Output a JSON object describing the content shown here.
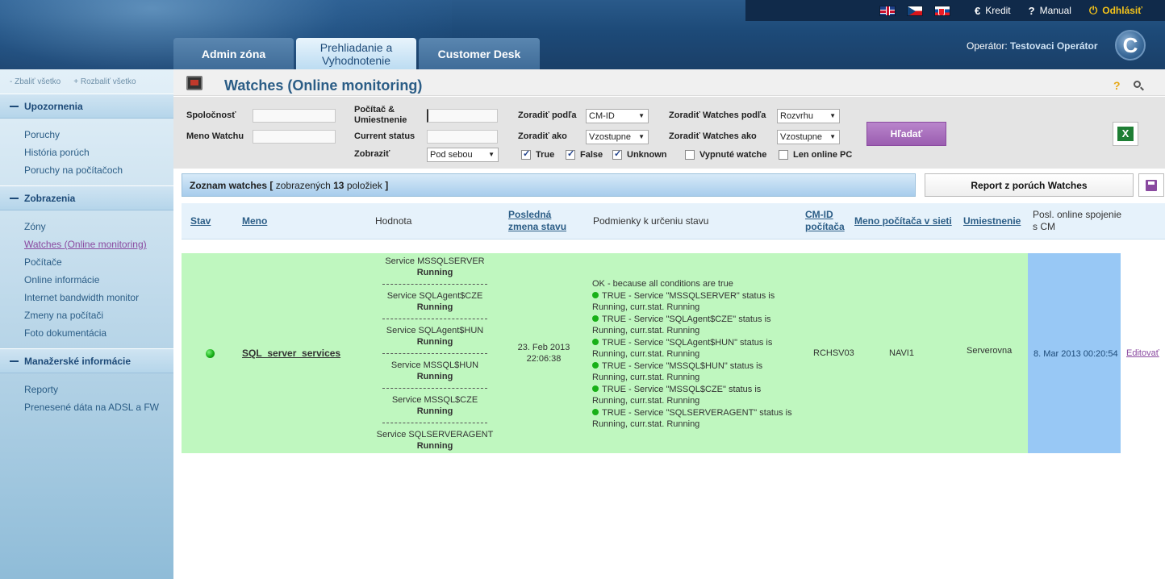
{
  "topbar": {
    "kredit": "Kredit",
    "manual": "Manual",
    "logout": "Odhlásiť"
  },
  "tabs": [
    {
      "label": "Admin zóna"
    },
    {
      "label": "Prehliadanie a Vyhodnotenie"
    },
    {
      "label": "Customer Desk"
    }
  ],
  "operator": {
    "label": "Operátor:",
    "name": "Testovaci Operátor"
  },
  "sidebar": {
    "collapse_all": "Zbaliť všetko",
    "expand_all": "Rozbaliť všetko",
    "sections": [
      {
        "title": "Upozornenia",
        "items": [
          "Poruchy",
          "História porúch",
          "Poruchy na počítačoch"
        ]
      },
      {
        "title": "Zobrazenia",
        "items": [
          "Zóny",
          "Watches (Online monitoring)",
          "Počítače",
          "Online informácie",
          "Internet bandwidth monitor",
          "Zmeny na počítači",
          "Foto dokumentácia"
        ]
      },
      {
        "title": "Manažerské informácie",
        "items": [
          "Reporty",
          "Prenesené dáta na ADSL a FW"
        ]
      }
    ]
  },
  "page": {
    "title": "Watches (Online monitoring)"
  },
  "filters": {
    "spolocnost": "Spoločnosť",
    "meno_watchu": "Meno Watchu",
    "pocitac_umiestnenie_1": "Počítač &",
    "pocitac_umiestnenie_2": "Umiestnenie",
    "current_status": "Current status",
    "zobrazit": "Zobraziť",
    "zobrazit_value": "Pod sebou",
    "zoradit_podla": "Zoradiť podľa",
    "zoradit_podla_value": "CM-ID",
    "zoradit_ako": "Zoradiť ako",
    "zoradit_ako_value": "Vzostupne",
    "zoradit_watches_podla": "Zoradiť Watches podľa",
    "zoradit_watches_podla_value": "Rozvrhu",
    "zoradit_watches_ako": "Zoradiť Watches ako",
    "zoradit_watches_ako_value": "Vzostupne",
    "chk_true": "True",
    "chk_false": "False",
    "chk_unknown": "Unknown",
    "chk_vypnute": "Vypnuté watche",
    "chk_online": "Len online PC",
    "search_button": "Hľadať"
  },
  "list": {
    "title": "Zoznam watches",
    "bracket_open": "[",
    "shown_text": "zobrazených",
    "count": "13",
    "items_text": "položiek",
    "bracket_close": "]",
    "report_button": "Report z porúch Watches"
  },
  "columns": {
    "stav": "Stav",
    "meno": "Meno",
    "hodnota": "Hodnota",
    "posledna_1": "Posledná",
    "posledna_2": "zmena stavu",
    "podmienky": "Podmienky k určeniu stavu",
    "cmid_1": "CM-ID",
    "cmid_2": "počítača",
    "meno_pocitaca": "Meno počítača v sieti",
    "umiestnenie": "Umiestnenie",
    "posl_online_1": "Posl. online spojenie",
    "posl_online_2": "s CM"
  },
  "row": {
    "meno": "SQL_server_services",
    "services": [
      {
        "name": "Service MSSQLSERVER",
        "status": "Running"
      },
      {
        "name": "Service SQLAgent$CZE",
        "status": "Running"
      },
      {
        "name": "Service SQLAgent$HUN",
        "status": "Running"
      },
      {
        "name": "Service MSSQL$HUN",
        "status": "Running"
      },
      {
        "name": "Service MSSQL$CZE",
        "status": "Running"
      },
      {
        "name": "Service SQLSERVERAGENT",
        "status": "Running"
      }
    ],
    "last_change_date": "23. Feb 2013",
    "last_change_time": "22:06:38",
    "conditions_ok": "OK - because all conditions are true",
    "conditions": [
      {
        "line1": "TRUE - Service \"MSSQLSERVER\" status is",
        "line2": "Running, curr.stat. Running"
      },
      {
        "line1": "TRUE - Service \"SQLAgent$CZE\" status is",
        "line2": "Running, curr.stat. Running"
      },
      {
        "line1": "TRUE - Service \"SQLAgent$HUN\" status is",
        "line2": "Running, curr.stat. Running"
      },
      {
        "line1": "TRUE - Service \"MSSQL$HUN\" status is",
        "line2": "Running, curr.stat. Running"
      },
      {
        "line1": "TRUE - Service \"MSSQL$CZE\" status is",
        "line2": "Running, curr.stat. Running"
      },
      {
        "line1": "TRUE - Service \"SQLSERVERAGENT\" status is",
        "line2": "Running, curr.stat. Running"
      }
    ],
    "cm_id": "RCHSV03",
    "computer_name": "NAVI1",
    "location": "Serverovna",
    "last_online": "8. Mar 2013 00:20:54",
    "edit": "Editovať"
  }
}
